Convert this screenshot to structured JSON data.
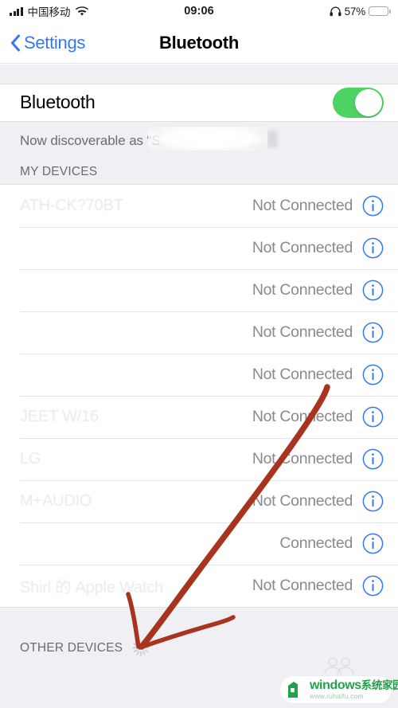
{
  "status_bar": {
    "carrier": "中国移动",
    "time": "09:06",
    "battery_percent": "57%",
    "battery_level": 57,
    "signal_bars": 4,
    "wifi_icon": "wifi-icon",
    "headphone_icon": "headphone-icon",
    "battery_color": "#FDCE2A"
  },
  "nav_bar": {
    "back_label": "Settings",
    "back_icon": "chevron-left-icon",
    "title": "Bluetooth",
    "accent_color": "#3478F6"
  },
  "bluetooth_toggle": {
    "label": "Bluetooth",
    "state": "on",
    "on_color": "#4CD364"
  },
  "discoverable": {
    "text": "Now discoverable as “S",
    "redacted_name": "███████████"
  },
  "my_devices": {
    "header": "MY DEVICES",
    "rows": [
      {
        "name": "ATH-CK?70BT",
        "status": "Not Connected",
        "info_icon": "info-circle-icon"
      },
      {
        "name": "",
        "status": "Not Connected",
        "info_icon": "info-circle-icon"
      },
      {
        "name": "",
        "status": "Not Connected",
        "info_icon": "info-circle-icon"
      },
      {
        "name": "",
        "status": "Not Connected",
        "info_icon": "info-circle-icon"
      },
      {
        "name": "",
        "status": "Not Connected",
        "info_icon": "info-circle-icon"
      },
      {
        "name": "JEET W/16",
        "status": "Not Connected",
        "info_icon": "info-circle-icon"
      },
      {
        "name": "LG",
        "status": "Not Connected",
        "info_icon": "info-circle-icon"
      },
      {
        "name": "M+AUDIO",
        "status": "Not Connected",
        "info_icon": "info-circle-icon"
      },
      {
        "name": "",
        "status": "Connected",
        "info_icon": "info-circle-icon"
      },
      {
        "name": "Shirl 的 Apple Watch",
        "status": "Not Connected",
        "info_icon": "info-circle-icon"
      }
    ]
  },
  "other_devices": {
    "header": "OTHER DEVICES",
    "spinner_icon": "activity-spinner-icon"
  },
  "annotation": {
    "color": "#A8331F",
    "type": "hand-drawn-arrow",
    "points_to": "activity-spinner-icon"
  },
  "watermark": {
    "title_en": "windows",
    "title_cn": "系统家园",
    "url": "www.ruhaifu.com",
    "logo_icon": "house-logo-icon",
    "brand_color": "#22A14A"
  }
}
